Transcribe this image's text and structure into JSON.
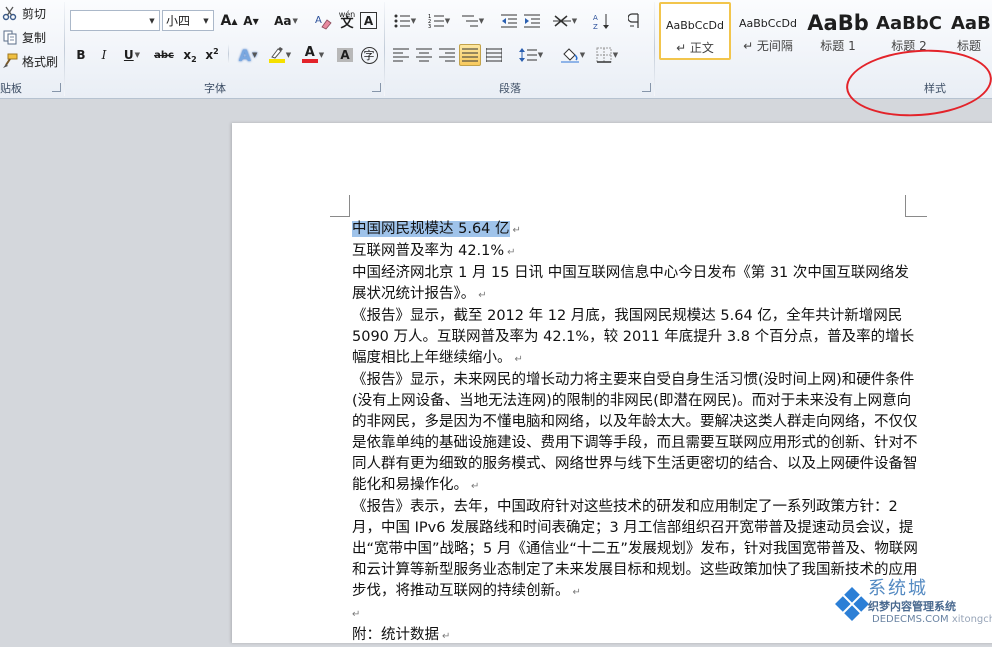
{
  "clipboard": {
    "cut_label": "剪切",
    "copy_label": "复制",
    "format_painter_label": "格式刷",
    "group_label": "贴板"
  },
  "font": {
    "family_value": "",
    "size_value": "小四",
    "group_label": "字体",
    "grow_label": "A",
    "shrink_label": "A",
    "case_label": "Aa",
    "pinyin_label": "wén",
    "bold_label": "B",
    "italic_label": "I",
    "underline_label": "U",
    "strike_label": "abc",
    "subscript_label": "x",
    "superscript_label": "x",
    "effect_label": "A",
    "color_label": "A",
    "shade_label": "A",
    "enclose_label": "字",
    "border_label": "A"
  },
  "paragraph": {
    "group_label": "段落"
  },
  "styles": {
    "group_label": "样式",
    "items": [
      {
        "preview": "AaBbCcDd",
        "name": "↵ 正文"
      },
      {
        "preview": "AaBbCcDd",
        "name": "↵ 无间隔"
      },
      {
        "preview": "AaBb",
        "name": "标题 1"
      },
      {
        "preview": "AaBbC",
        "name": "标题 2"
      },
      {
        "preview": "AaB",
        "name": "标题"
      }
    ]
  },
  "colors": {
    "highlight": "#f5e000",
    "font_color": "#e3232a",
    "annotation": "#e3232a",
    "selection": "#9fc3ea"
  },
  "document": {
    "paragraphs": [
      {
        "text": "中国网民规模达 5.64 亿",
        "selected": true
      },
      {
        "text": "互联网普及率为 42.1%",
        "selected": false
      },
      {
        "text": "中国经济网北京 1 月 15 日讯  中国互联网信息中心今日发布《第 31 次中国互联网络发展状况统计报告》。",
        "selected": false
      },
      {
        "text": "《报告》显示，截至 2012 年 12 月底，我国网民规模达 5.64 亿，全年共计新增网民 5090 万人。互联网普及率为 42.1%，较 2011 年底提升 3.8 个百分点，普及率的增长幅度相比上年继续缩小。",
        "selected": false
      },
      {
        "text": "《报告》显示，未来网民的增长动力将主要来自受自身生活习惯(没时间上网)和硬件条件(没有上网设备、当地无法连网)的限制的非网民(即潜在网民)。而对于未来没有上网意向的非网民，多是因为不懂电脑和网络，以及年龄太大。要解决这类人群走向网络，不仅仅是依靠单纯的基础设施建设、费用下调等手段，而且需要互联网应用形式的创新、针对不同人群有更为细致的服务模式、网络世界与线下生活更密切的结合、以及上网硬件设备智能化和易操作化。",
        "selected": false
      },
      {
        "text": "《报告》表示，去年，中国政府针对这些技术的研发和应用制定了一系列政策方针：2 月，中国 IPv6 发展路线和时间表确定；3 月工信部组织召开宽带普及提速动员会议，提出“宽带中国”战略；5 月《通信业“十二五”发展规划》发布，针对我国宽带普及、物联网和云计算等新型服务业态制定了未来发展目标和规划。这些政策加快了我国新技术的应用步伐，将推动互联网的持续创新。",
        "selected": false
      },
      {
        "text": "",
        "selected": false
      },
      {
        "text": "附：统计数据",
        "selected": false
      }
    ]
  },
  "watermark": {
    "title": "系统城",
    "subtitle": "织梦内容管理系统",
    "url": "DEDECMS.COM",
    "url2": "xitongcheng.com"
  }
}
